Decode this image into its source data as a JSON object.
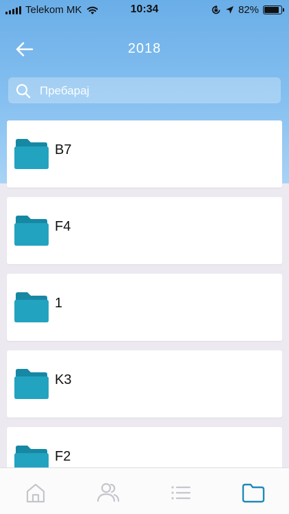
{
  "status_bar": {
    "carrier": "Telekom MK",
    "time": "10:34",
    "battery_percent": "82%",
    "battery_level": 0.82,
    "icons": [
      "signal-icon",
      "wifi-icon",
      "orientation-lock-icon",
      "location-icon",
      "battery-icon"
    ]
  },
  "header": {
    "title": "2018",
    "back_icon": "arrow-left-icon"
  },
  "search": {
    "placeholder": "Пребарај",
    "value": ""
  },
  "folders": [
    {
      "name": "B7"
    },
    {
      "name": "F4"
    },
    {
      "name": "1"
    },
    {
      "name": "K3"
    },
    {
      "name": "F2"
    }
  ],
  "tab_bar": {
    "tabs": [
      {
        "icon": "home-icon",
        "active": false
      },
      {
        "icon": "users-icon",
        "active": false
      },
      {
        "icon": "list-icon",
        "active": false
      },
      {
        "icon": "folder-icon",
        "active": true
      }
    ]
  },
  "colors": {
    "header_gradient_top": "#6aaee8",
    "folder_icon": "#1fa0bd",
    "tab_active": "#1e8ab8",
    "tab_inactive": "#c4c6cc"
  }
}
